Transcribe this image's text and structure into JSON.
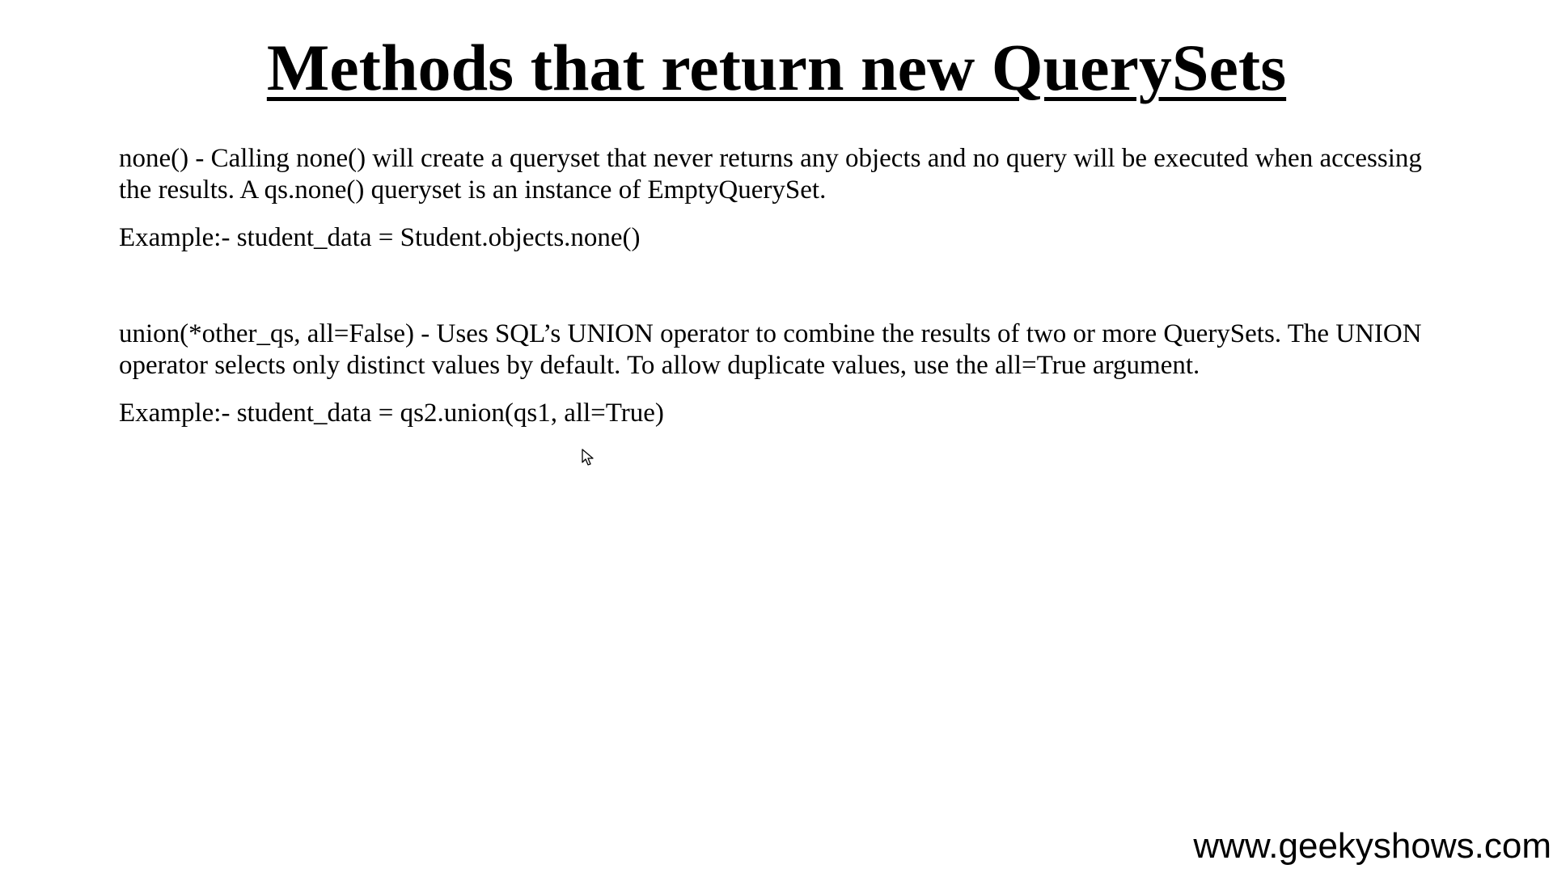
{
  "slide": {
    "title": "Methods that return new QuerySets",
    "sections": [
      {
        "description": "none() - Calling none() will create a queryset that never returns any objects and no query will be executed when accessing the results. A qs.none() queryset is an instance of EmptyQuerySet.",
        "example": "Example:- student_data = Student.objects.none()"
      },
      {
        "description": "union(*other_qs, all=False) - Uses SQL’s UNION operator to combine the results of two or more QuerySets. The UNION operator selects only distinct values by default. To allow duplicate values, use the all=True argument.",
        "example": "Example:- student_data = qs2.union(qs1, all=True)"
      }
    ]
  },
  "watermark": "www.geekyshows.com",
  "icons": {
    "cursor": "mouse-pointer-icon"
  }
}
